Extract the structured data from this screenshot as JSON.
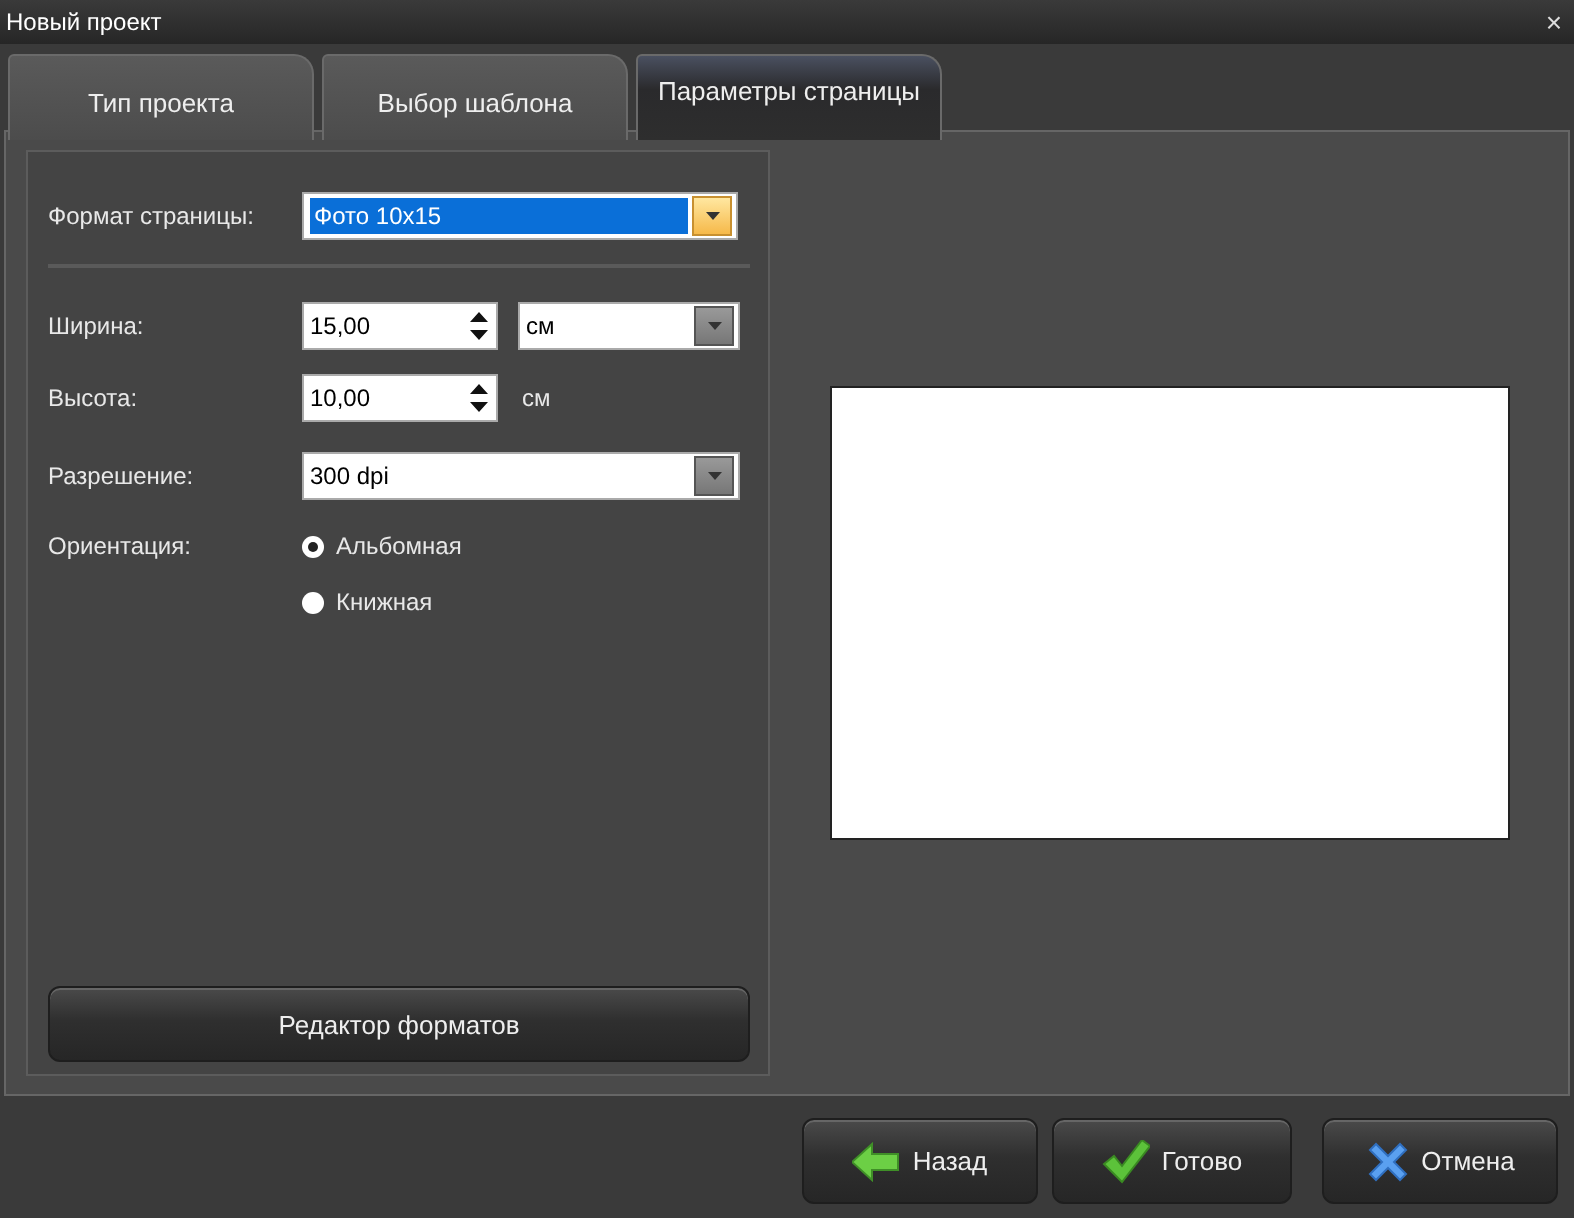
{
  "window": {
    "title": "Новый проект",
    "close": "×"
  },
  "tabs": [
    {
      "label": "Тип проекта",
      "selected": false
    },
    {
      "label": "Выбор шаблона",
      "selected": false
    },
    {
      "label": "Параметры страницы",
      "selected": true
    }
  ],
  "form": {
    "format": {
      "label": "Формат страницы:",
      "value": "Фото 10x15"
    },
    "width": {
      "label": "Ширина:",
      "value": "15,00",
      "unit": "см"
    },
    "height": {
      "label": "Высота:",
      "value": "10,00",
      "unit": "см"
    },
    "resolution": {
      "label": "Разрешение:",
      "value": "300 dpi"
    },
    "orientation": {
      "label": "Ориентация:",
      "options": [
        {
          "label": "Альбомная",
          "selected": true
        },
        {
          "label": "Книжная",
          "selected": false
        }
      ]
    },
    "editor_button": "Редактор форматов"
  },
  "buttons": [
    {
      "label": "Назад",
      "kind": "back"
    },
    {
      "label": "Готово",
      "kind": "done"
    },
    {
      "label": "Отмена",
      "kind": "cancel"
    }
  ]
}
